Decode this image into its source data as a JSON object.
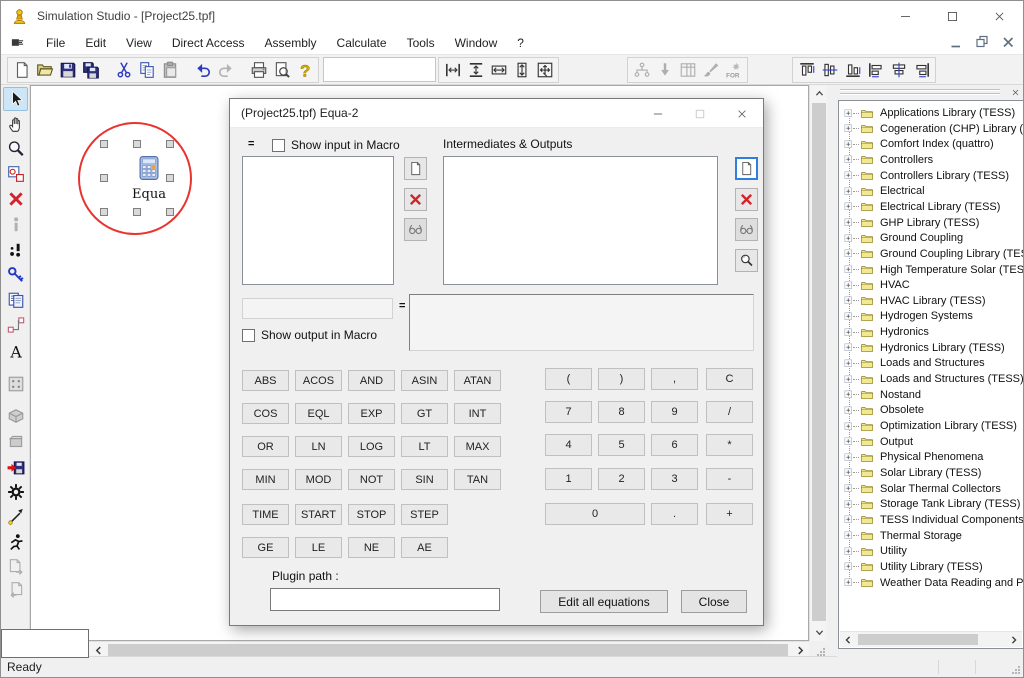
{
  "window": {
    "title": "Simulation Studio - [Project25.tpf]"
  },
  "menu_bar": {
    "items": [
      "File",
      "Edit",
      "View",
      "Direct Access",
      "Assembly",
      "Calculate",
      "Tools",
      "Window",
      "?"
    ]
  },
  "main_toolbar": {
    "groups": [
      {
        "items": [
          {
            "name": "new-file",
            "icon": "new-file"
          },
          {
            "name": "open-file",
            "icon": "open-folder"
          },
          {
            "name": "save",
            "icon": "save"
          },
          {
            "name": "save-all",
            "icon": "save-all"
          },
          {
            "name": "cut",
            "icon": "cut"
          },
          {
            "name": "copy",
            "icon": "copy"
          },
          {
            "name": "paste",
            "icon": "paste",
            "disabled": true
          },
          {
            "name": "undo",
            "icon": "undo"
          },
          {
            "name": "redo",
            "icon": "redo",
            "disabled": true
          },
          {
            "name": "print",
            "icon": "print"
          },
          {
            "name": "print-preview",
            "icon": "print-preview"
          },
          {
            "name": "help",
            "icon": "help"
          }
        ]
      },
      {
        "items": [
          {
            "name": "space-horizontal",
            "icon": "space-h"
          },
          {
            "name": "space-vertical",
            "icon": "space-v"
          },
          {
            "name": "make-same-width",
            "icon": "size-h"
          },
          {
            "name": "make-same-height",
            "icon": "size-v"
          },
          {
            "name": "make-same-size",
            "icon": "size-both"
          }
        ]
      },
      {
        "items": [
          {
            "name": "org-chart",
            "icon": "org-chart",
            "disabled": true
          },
          {
            "name": "download-arrow",
            "icon": "arrow-down",
            "disabled": true
          },
          {
            "name": "table",
            "icon": "grid-table",
            "disabled": true
          },
          {
            "name": "paintbrush",
            "icon": "paintbrush",
            "disabled": true
          },
          {
            "name": "for-wizard",
            "icon": "for-wizard",
            "disabled": true
          }
        ]
      },
      {
        "items": [
          {
            "name": "align-top",
            "icon": "align-top"
          },
          {
            "name": "align-vertical-center",
            "icon": "align-middle"
          },
          {
            "name": "align-bottom",
            "icon": "align-bottom"
          },
          {
            "name": "align-left",
            "icon": "align-left"
          },
          {
            "name": "align-horizontal-center",
            "icon": "align-center"
          },
          {
            "name": "align-right",
            "icon": "align-right"
          }
        ]
      }
    ]
  },
  "left_toolbar": {
    "items": [
      {
        "name": "select-cursor",
        "icon": "cursor",
        "selected": true
      },
      {
        "name": "pan-hand",
        "icon": "hand"
      },
      {
        "name": "zoom",
        "icon": "zoom"
      },
      {
        "name": "region-select",
        "icon": "region-select"
      },
      {
        "name": "delete",
        "icon": "delete"
      },
      {
        "name": "info",
        "icon": "info",
        "disabled": true
      },
      {
        "name": "breakpoint",
        "icon": "breakpoint"
      },
      {
        "name": "key",
        "icon": "key"
      },
      {
        "name": "copy-document",
        "icon": "copy-doc"
      },
      {
        "name": "link-components",
        "icon": "link-nodes"
      },
      {
        "name": "text-label",
        "icon": "text-label"
      },
      {
        "name": "grid-macro",
        "icon": "grid-dots",
        "disabled": true
      },
      {
        "name": "brick",
        "icon": "gray-brick",
        "disabled": true
      },
      {
        "name": "block",
        "icon": "gray-block",
        "disabled": true
      },
      {
        "name": "export-save",
        "icon": "export-save"
      },
      {
        "name": "settings-gear",
        "icon": "gear"
      },
      {
        "name": "probe-arrow",
        "icon": "probe"
      },
      {
        "name": "run-simulation",
        "icon": "run-man"
      },
      {
        "name": "page-export",
        "icon": "page-export",
        "disabled": true
      },
      {
        "name": "page-import",
        "icon": "page-import",
        "disabled": true
      }
    ]
  },
  "canvas": {
    "component_label": "Equa"
  },
  "dialog": {
    "title": "(Project25.tpf) Equa-2",
    "equals_top": "=",
    "show_input_label": "Show input in Macro",
    "intermediates_label": "Intermediates & Outputs",
    "equals_mid": "=",
    "show_output_label": "Show output in Macro",
    "input_value": "",
    "plugin_path_label": "Plugin path :",
    "plugin_path_value": "",
    "edit_all_label": "Edit all equations",
    "close_label": "Close",
    "input_buttons": [
      {
        "name": "new-input",
        "icon": "new-file"
      },
      {
        "name": "delete-input",
        "icon": "delete"
      },
      {
        "name": "view-input",
        "icon": "spectacles",
        "disabled": true
      }
    ],
    "output_buttons": [
      {
        "name": "new-output",
        "icon": "new-file",
        "focused": true
      },
      {
        "name": "delete-output",
        "icon": "delete"
      },
      {
        "name": "view-output",
        "icon": "spectacles",
        "disabled": true
      },
      {
        "name": "search-output",
        "icon": "magnifier"
      }
    ],
    "function_rows": [
      [
        "ABS",
        "ACOS",
        "AND",
        "ASIN",
        "ATAN"
      ],
      [
        "COS",
        "EQL",
        "EXP",
        "GT",
        "INT"
      ],
      [
        "OR",
        "LN",
        "LOG",
        "LT",
        "MAX"
      ],
      [
        "MIN",
        "MOD",
        "NOT",
        "SIN",
        "TAN"
      ],
      [
        "TIME",
        "START",
        "STOP",
        "STEP"
      ],
      [
        "GE",
        "LE",
        "NE",
        "AE"
      ]
    ],
    "numpad_rows": [
      [
        "(",
        ")",
        ",",
        "C"
      ],
      [
        "7",
        "8",
        "9",
        "/"
      ],
      [
        "4",
        "5",
        "6",
        "*"
      ],
      [
        "1",
        "2",
        "3",
        "-"
      ]
    ],
    "numpad_last": [
      "0",
      ".",
      "+"
    ]
  },
  "library_tree": {
    "items": [
      "Applications Library (TESS)",
      "Cogeneration (CHP) Library (T",
      "Comfort Index (quattro)",
      "Controllers",
      "Controllers Library (TESS)",
      "Electrical",
      "Electrical Library (TESS)",
      "GHP Library (TESS)",
      "Ground Coupling",
      "Ground Coupling Library (TES",
      "High Temperature Solar (TES",
      "HVAC",
      "HVAC Library (TESS)",
      "Hydrogen Systems",
      "Hydronics",
      "Hydronics Library (TESS)",
      "Loads and Structures",
      "Loads and Structures (TESS)",
      "Nostand",
      "Obsolete",
      "Optimization Library (TESS)",
      "Output",
      "Physical Phenomena",
      "Solar Library (TESS)",
      "Solar Thermal Collectors",
      "Storage Tank Library (TESS)",
      "TESS Individual Components",
      "Thermal Storage",
      "Utility",
      "Utility Library (TESS)",
      "Weather Data Reading and P"
    ]
  },
  "status_bar": {
    "text": "Ready"
  },
  "colors": {
    "selection_circle": "#e8332e",
    "delete_red": "#d2232a",
    "folder_yellow": "#f2e88f",
    "focus_blue": "#2f7fe0",
    "selected_tool_bg": "#cde6f7"
  }
}
